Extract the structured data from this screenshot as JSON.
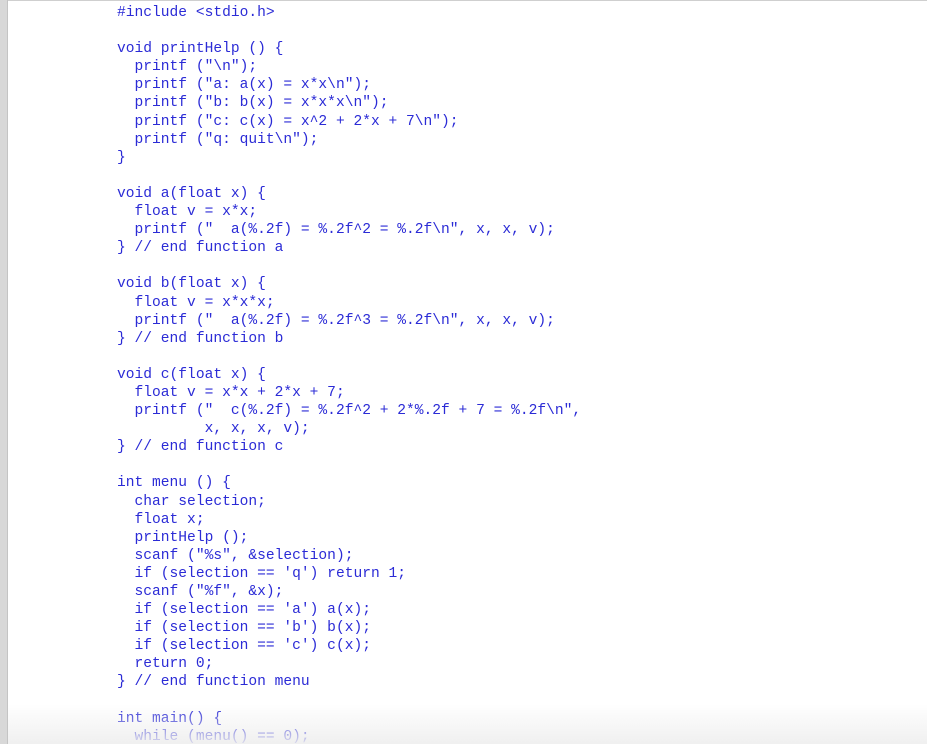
{
  "document": {
    "language": "c",
    "text_color": "#2b2bd6",
    "lines": [
      "#include <stdio.h>",
      "",
      "void printHelp () {",
      "  printf (\"\\n\");",
      "  printf (\"a: a(x) = x*x\\n\");",
      "  printf (\"b: b(x) = x*x*x\\n\");",
      "  printf (\"c: c(x) = x^2 + 2*x + 7\\n\");",
      "  printf (\"q: quit\\n\");",
      "}",
      "",
      "void a(float x) {",
      "  float v = x*x;",
      "  printf (\"  a(%.2f) = %.2f^2 = %.2f\\n\", x, x, v);",
      "} // end function a",
      "",
      "void b(float x) {",
      "  float v = x*x*x;",
      "  printf (\"  a(%.2f) = %.2f^3 = %.2f\\n\", x, x, v);",
      "} // end function b",
      "",
      "void c(float x) {",
      "  float v = x*x + 2*x + 7;",
      "  printf (\"  c(%.2f) = %.2f^2 + 2*%.2f + 7 = %.2f\\n\",",
      "          x, x, x, v);",
      "} // end function c",
      "",
      "int menu () {",
      "  char selection;",
      "  float x;",
      "  printHelp ();",
      "  scanf (\"%s\", &selection);",
      "  if (selection == 'q') return 1;",
      "  scanf (\"%f\", &x);",
      "  if (selection == 'a') a(x);",
      "  if (selection == 'b') b(x);",
      "  if (selection == 'c') c(x);",
      "  return 0;",
      "} // end function menu",
      "",
      "int main() {",
      "  while (menu() == 0);"
    ]
  }
}
